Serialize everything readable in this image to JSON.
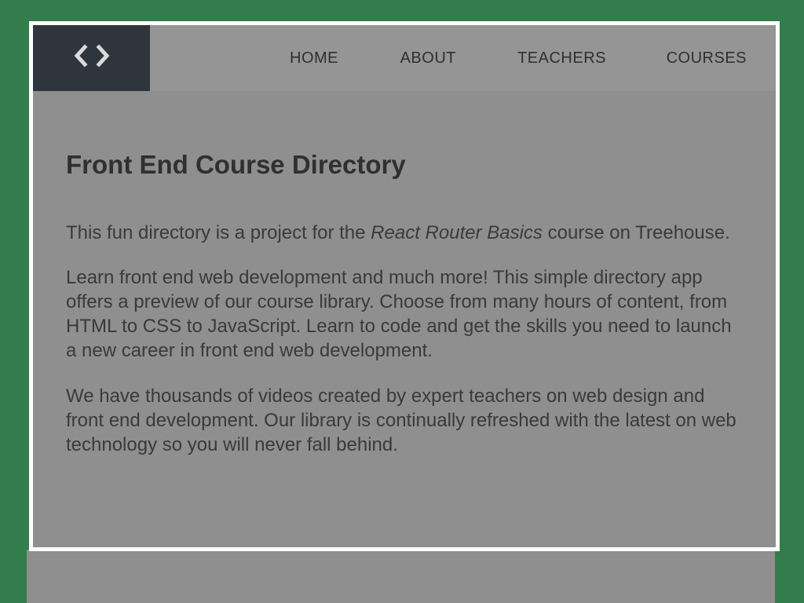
{
  "header": {
    "logo_icon": "code-brackets-icon",
    "nav": [
      {
        "label": "HOME"
      },
      {
        "label": "ABOUT"
      },
      {
        "label": "TEACHERS"
      },
      {
        "label": "COURSES"
      }
    ]
  },
  "main": {
    "title": "Front End Course Directory",
    "intro": {
      "before": "This fun directory is a project for the ",
      "course_name": "React Router Basics",
      "after": " course on Treehouse."
    },
    "paragraph2": "Learn front end web development and much more! This simple directory app offers a preview of our course library. Choose from many hours of content, from HTML to CSS to JavaScript. Learn to code and get the skills you need to launch a new career in front end web development.",
    "paragraph3": "We have thousands of videos created by expert teachers on web design and front end development. Our library is continually refreshed with the latest on web technology so you will never fall behind."
  },
  "colors": {
    "outer_background": "#327d4b",
    "page_background": "#8f8f8f",
    "header_background": "#959595",
    "logo_background": "#2f353c",
    "frame_border": "#ffffff"
  }
}
